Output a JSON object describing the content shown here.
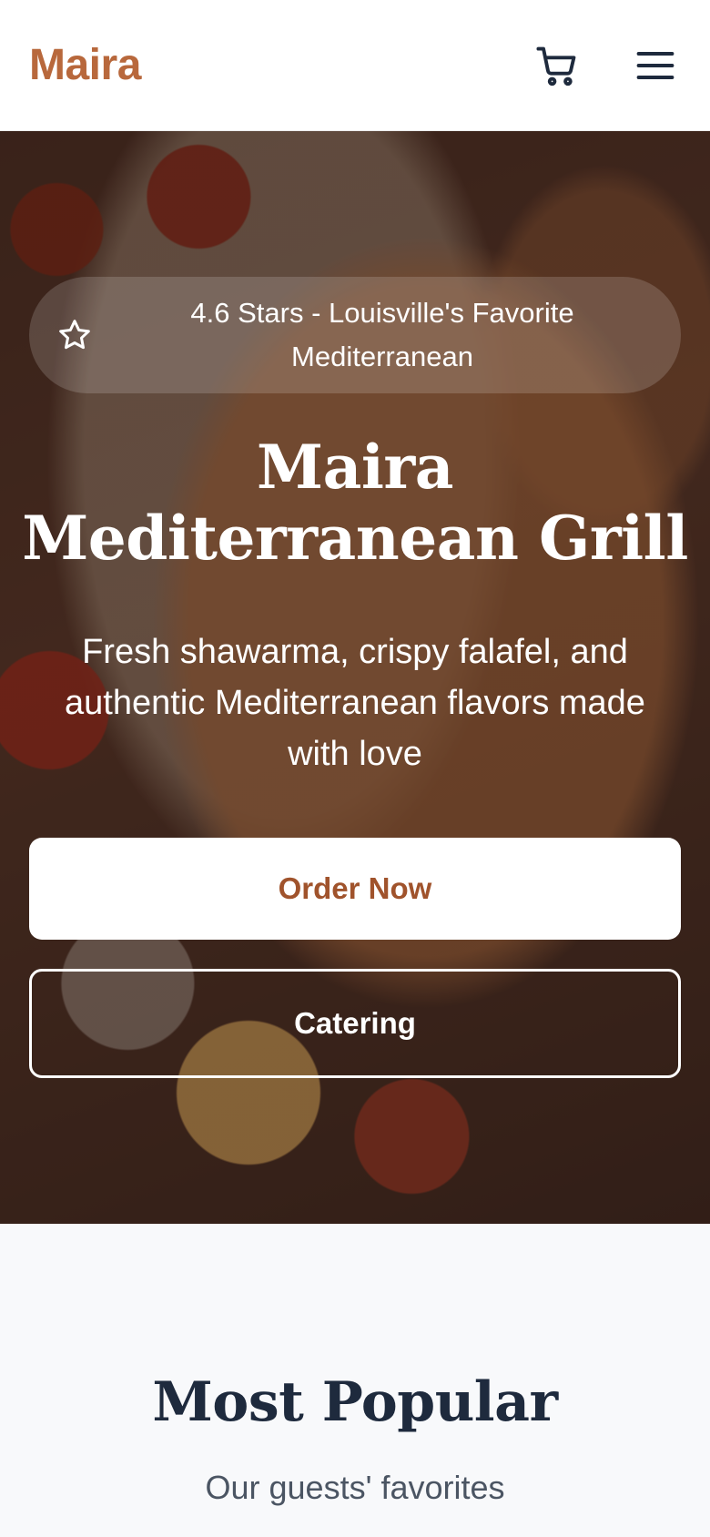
{
  "header": {
    "brand": "Maira",
    "brand_color": "#b8683c",
    "cart_icon": "shopping-cart-icon",
    "menu_icon": "hamburger-menu-icon"
  },
  "hero": {
    "rating_badge": "4.6 Stars - Louisville's Favorite Mediterranean",
    "badge_icon": "star-icon",
    "title": "Maira Mediterranean Grill",
    "subtitle": "Fresh shawarma, crispy falafel, and authentic Mediterranean flavors made with love",
    "primary_button": "Order Now",
    "secondary_button": "Catering",
    "primary_text_color": "#a0532c"
  },
  "popular": {
    "title": "Most Popular",
    "subtitle": "Our guests' favorites"
  }
}
